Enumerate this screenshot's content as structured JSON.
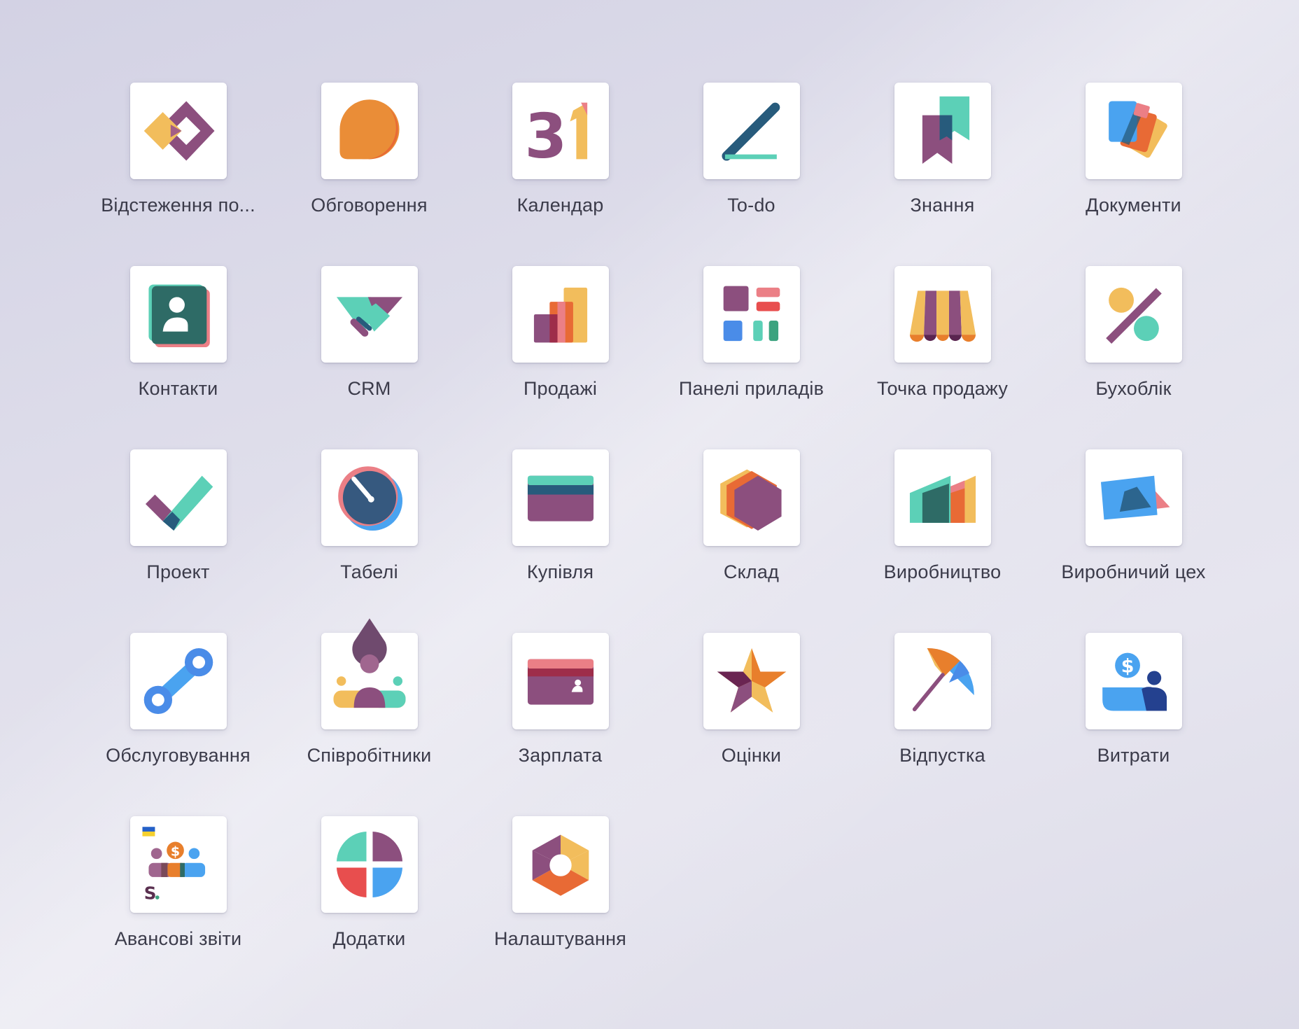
{
  "apps": [
    {
      "label": "Відстеження по...",
      "icon": "helpdesk-icon"
    },
    {
      "label": "Обговорення",
      "icon": "discuss-icon"
    },
    {
      "label": "Календар",
      "icon": "calendar-icon"
    },
    {
      "label": "To-do",
      "icon": "todo-icon"
    },
    {
      "label": "Знання",
      "icon": "knowledge-icon"
    },
    {
      "label": "Документи",
      "icon": "documents-icon"
    },
    {
      "label": "Контакти",
      "icon": "contacts-icon"
    },
    {
      "label": "CRM",
      "icon": "crm-icon"
    },
    {
      "label": "Продажі",
      "icon": "sales-icon"
    },
    {
      "label": "Панелі приладів",
      "icon": "dashboards-icon"
    },
    {
      "label": "Точка продажу",
      "icon": "point-of-sale-icon"
    },
    {
      "label": "Бухоблік",
      "icon": "accounting-icon"
    },
    {
      "label": "Проект",
      "icon": "project-icon"
    },
    {
      "label": "Табелі",
      "icon": "timesheets-icon"
    },
    {
      "label": "Купівля",
      "icon": "purchase-icon"
    },
    {
      "label": "Склад",
      "icon": "inventory-icon"
    },
    {
      "label": "Виробництво",
      "icon": "manufacturing-icon"
    },
    {
      "label": "Виробничий цех",
      "icon": "shop-floor-icon"
    },
    {
      "label": "Обслуговування",
      "icon": "maintenance-icon"
    },
    {
      "label": "Співробітники",
      "icon": "employees-icon"
    },
    {
      "label": "Зарплата",
      "icon": "payroll-icon"
    },
    {
      "label": "Оцінки",
      "icon": "appraisals-icon"
    },
    {
      "label": "Відпустка",
      "icon": "time-off-icon"
    },
    {
      "label": "Витрати",
      "icon": "expenses-icon"
    },
    {
      "label": "Авансові звіти",
      "icon": "advance-reports-icon"
    },
    {
      "label": "Додатки",
      "icon": "apps-icon"
    },
    {
      "label": "Налаштування",
      "icon": "settings-icon"
    }
  ]
}
